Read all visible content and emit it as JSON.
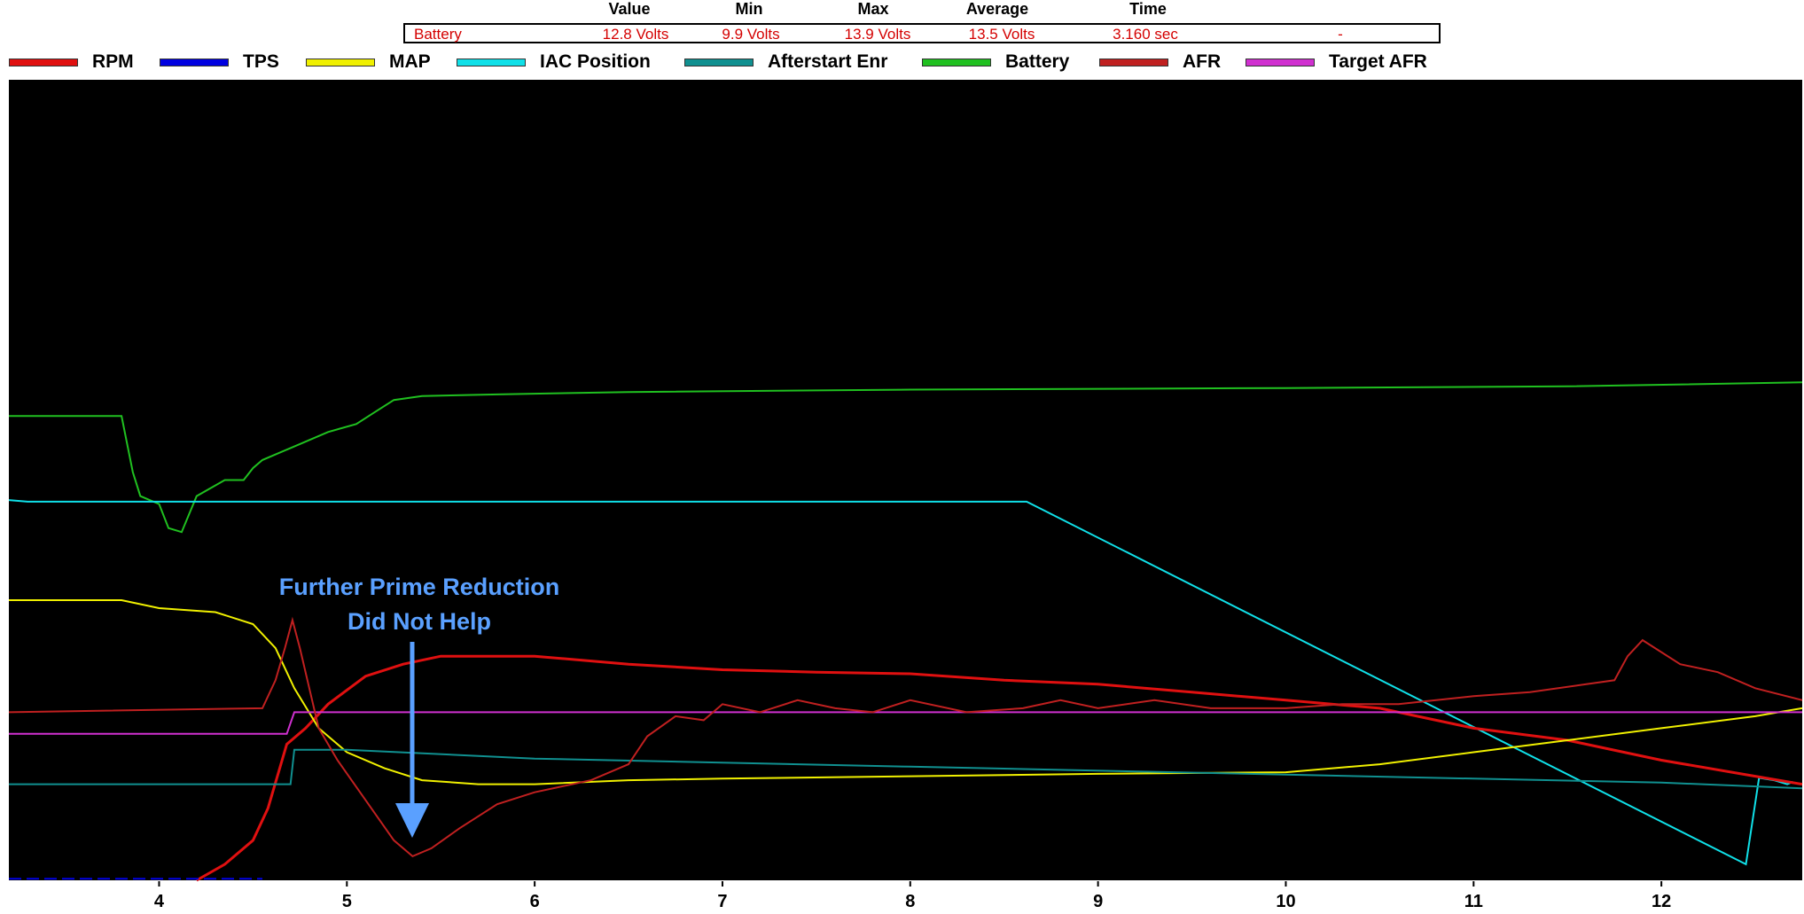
{
  "stats": {
    "headers": [
      "Value",
      "Min",
      "Max",
      "Average",
      "Time"
    ],
    "channel": "Battery",
    "value": "12.8 Volts",
    "min": "9.9 Volts",
    "max": "13.9 Volts",
    "average": "13.5 Volts",
    "time": "3.160 sec",
    "extra": "-"
  },
  "legend": [
    {
      "name": "RPM",
      "color": "#e01010"
    },
    {
      "name": "TPS",
      "color": "#0000e0"
    },
    {
      "name": "MAP",
      "color": "#f0f000"
    },
    {
      "name": "IAC Position",
      "color": "#10e0e8"
    },
    {
      "name": "Afterstart Enr",
      "color": "#109090"
    },
    {
      "name": "Battery",
      "color": "#20c020"
    },
    {
      "name": "AFR",
      "color": "#c02020"
    },
    {
      "name": "Target AFR",
      "color": "#d030d0"
    }
  ],
  "annotation": {
    "line1": "Further Prime Reduction",
    "line2": "Did Not Help",
    "color": "#5aa0ff"
  },
  "chart_data": {
    "type": "line",
    "x_unit": "sec",
    "xlim": [
      3.2,
      12.75
    ],
    "ylim": [
      0,
      100
    ],
    "x_ticks": [
      "4",
      "5",
      "6",
      "7",
      "8",
      "9",
      "10",
      "11",
      "12"
    ],
    "grid": false,
    "legend_position": "top",
    "series": [
      {
        "name": "Battery",
        "color": "#20c020",
        "points": [
          [
            3.2,
            58
          ],
          [
            3.8,
            58
          ],
          [
            3.86,
            51
          ],
          [
            3.9,
            48
          ],
          [
            4.0,
            47
          ],
          [
            4.05,
            44
          ],
          [
            4.12,
            43.5
          ],
          [
            4.2,
            48
          ],
          [
            4.35,
            50
          ],
          [
            4.45,
            50
          ],
          [
            4.5,
            51.5
          ],
          [
            4.55,
            52.5
          ],
          [
            4.7,
            54
          ],
          [
            4.9,
            56
          ],
          [
            5.05,
            57
          ],
          [
            5.15,
            58.5
          ],
          [
            5.25,
            60
          ],
          [
            5.4,
            60.5
          ],
          [
            5.8,
            60.7
          ],
          [
            6.5,
            61
          ],
          [
            8.0,
            61.3
          ],
          [
            10.0,
            61.5
          ],
          [
            11.5,
            61.7
          ],
          [
            12.75,
            62.2
          ]
        ]
      },
      {
        "name": "IAC Position",
        "color": "#10e0e8",
        "points": [
          [
            3.2,
            47.5
          ],
          [
            3.3,
            47.3
          ],
          [
            8.62,
            47.3
          ],
          [
            12.45,
            2.0
          ],
          [
            12.52,
            12.8
          ],
          [
            12.6,
            12.5
          ],
          [
            12.67,
            12.0
          ],
          [
            12.7,
            12.3
          ]
        ]
      },
      {
        "name": "RPM",
        "color": "#e01010",
        "points": [
          [
            4.2,
            0
          ],
          [
            4.35,
            2
          ],
          [
            4.5,
            5
          ],
          [
            4.58,
            9
          ],
          [
            4.68,
            17
          ],
          [
            4.78,
            19
          ],
          [
            4.9,
            22
          ],
          [
            5.1,
            25.5
          ],
          [
            5.3,
            27
          ],
          [
            5.5,
            28
          ],
          [
            6.0,
            28
          ],
          [
            6.5,
            27
          ],
          [
            7.0,
            26.3
          ],
          [
            7.5,
            26
          ],
          [
            8.0,
            25.8
          ],
          [
            8.5,
            25
          ],
          [
            9.0,
            24.5
          ],
          [
            9.5,
            23.5
          ],
          [
            10.0,
            22.5
          ],
          [
            10.5,
            21.5
          ],
          [
            11.0,
            19
          ],
          [
            11.5,
            17.5
          ],
          [
            12.0,
            15
          ],
          [
            12.5,
            13
          ],
          [
            12.75,
            12
          ]
        ]
      },
      {
        "name": "MAP",
        "color": "#f0f000",
        "points": [
          [
            3.2,
            35
          ],
          [
            3.8,
            35
          ],
          [
            4.0,
            34
          ],
          [
            4.3,
            33.5
          ],
          [
            4.5,
            32
          ],
          [
            4.62,
            29
          ],
          [
            4.72,
            24
          ],
          [
            4.85,
            19
          ],
          [
            5.0,
            16
          ],
          [
            5.2,
            14
          ],
          [
            5.4,
            12.5
          ],
          [
            5.7,
            12
          ],
          [
            6.0,
            12
          ],
          [
            6.5,
            12.5
          ],
          [
            7.0,
            12.7
          ],
          [
            8.0,
            13
          ],
          [
            9.0,
            13.3
          ],
          [
            10.0,
            13.5
          ],
          [
            10.5,
            14.5
          ],
          [
            11.0,
            16
          ],
          [
            11.5,
            17.5
          ],
          [
            12.0,
            19
          ],
          [
            12.5,
            20.5
          ],
          [
            12.75,
            21.5
          ]
        ]
      },
      {
        "name": "Afterstart Enr",
        "color": "#109090",
        "points": [
          [
            3.2,
            12
          ],
          [
            4.7,
            12
          ],
          [
            4.72,
            16.3
          ],
          [
            5.0,
            16.3
          ],
          [
            6.0,
            15.2
          ],
          [
            8.0,
            14.2
          ],
          [
            10.0,
            13.2
          ],
          [
            12.0,
            12.2
          ],
          [
            12.75,
            11.5
          ]
        ]
      },
      {
        "name": "Target AFR",
        "color": "#d030d0",
        "points": [
          [
            3.2,
            18.3
          ],
          [
            4.68,
            18.3
          ],
          [
            4.72,
            21
          ],
          [
            12.75,
            21
          ]
        ]
      },
      {
        "name": "AFR",
        "color": "#c02020",
        "points": [
          [
            3.2,
            21
          ],
          [
            4.55,
            21.5
          ],
          [
            4.62,
            25
          ],
          [
            4.67,
            29
          ],
          [
            4.71,
            32.5
          ],
          [
            4.75,
            29
          ],
          [
            4.8,
            24
          ],
          [
            4.85,
            19
          ],
          [
            4.95,
            15
          ],
          [
            5.1,
            10
          ],
          [
            5.25,
            5
          ],
          [
            5.35,
            3
          ],
          [
            5.45,
            4
          ],
          [
            5.6,
            6.5
          ],
          [
            5.8,
            9.5
          ],
          [
            6.0,
            11
          ],
          [
            6.3,
            12.5
          ],
          [
            6.5,
            14.5
          ],
          [
            6.6,
            18
          ],
          [
            6.75,
            20.5
          ],
          [
            6.9,
            20
          ],
          [
            7.0,
            22
          ],
          [
            7.2,
            21
          ],
          [
            7.4,
            22.5
          ],
          [
            7.6,
            21.5
          ],
          [
            7.8,
            21
          ],
          [
            8.0,
            22.5
          ],
          [
            8.3,
            21
          ],
          [
            8.6,
            21.5
          ],
          [
            8.8,
            22.5
          ],
          [
            9.0,
            21.5
          ],
          [
            9.3,
            22.5
          ],
          [
            9.6,
            21.5
          ],
          [
            10.0,
            21.5
          ],
          [
            10.3,
            22
          ],
          [
            10.6,
            22
          ],
          [
            11.0,
            23
          ],
          [
            11.3,
            23.5
          ],
          [
            11.6,
            24.5
          ],
          [
            11.75,
            25
          ],
          [
            11.82,
            28
          ],
          [
            11.9,
            30
          ],
          [
            12.1,
            27
          ],
          [
            12.3,
            26
          ],
          [
            12.5,
            24
          ],
          [
            12.75,
            22.5
          ]
        ]
      },
      {
        "name": "TPS",
        "color": "#0000e0",
        "points": [
          [
            3.2,
            0.2
          ],
          [
            4.55,
            0.2
          ]
        ]
      }
    ]
  }
}
